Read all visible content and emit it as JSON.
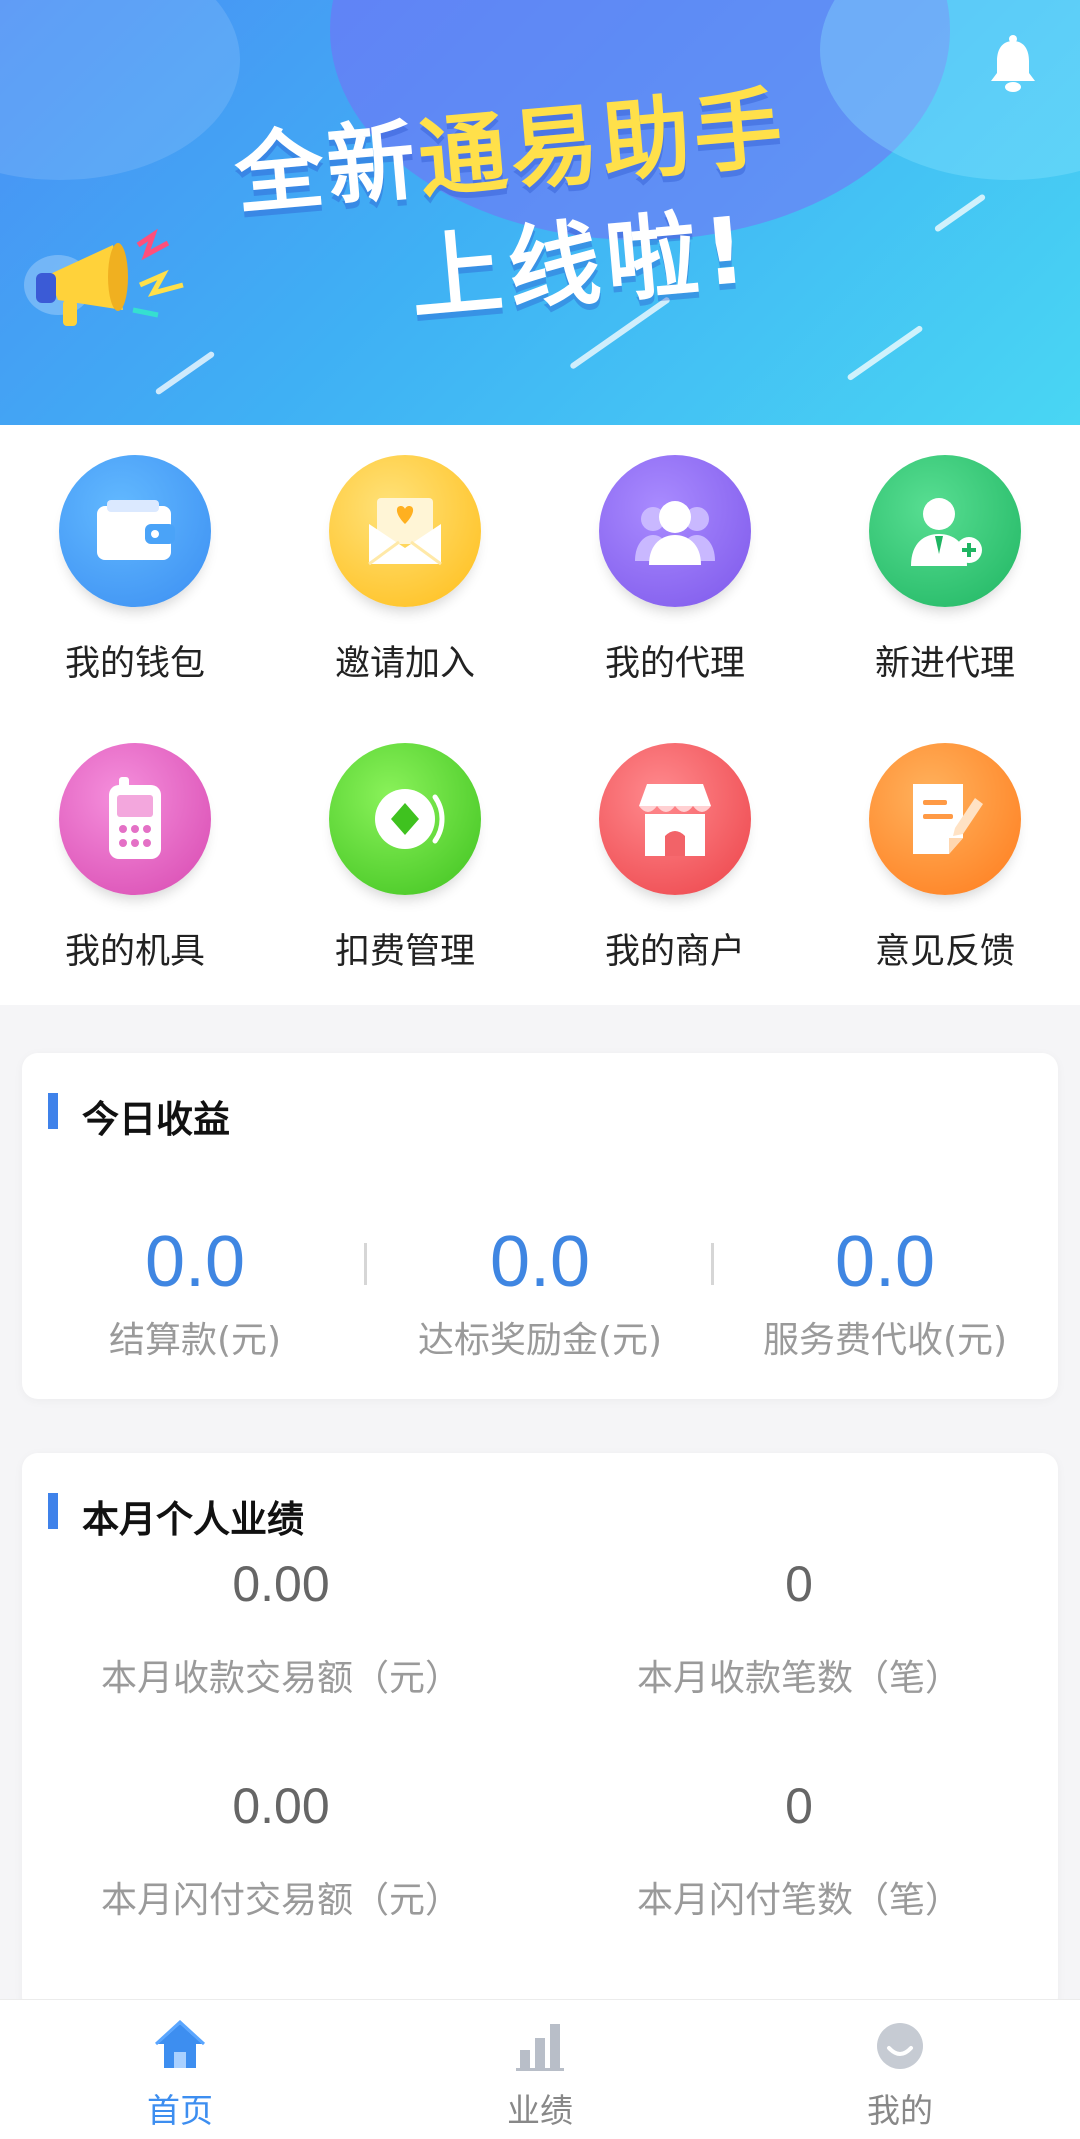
{
  "banner": {
    "title_line1_plain": "全新",
    "title_line1_highlight": "通易助手",
    "title_line2": "上线啦!"
  },
  "menu": {
    "items": [
      {
        "label": "我的钱包",
        "icon": "wallet-icon",
        "color": "#3b8ef2"
      },
      {
        "label": "邀请加入",
        "icon": "invite-envelope-icon",
        "color": "#ffc21f"
      },
      {
        "label": "我的代理",
        "icon": "agents-icon",
        "color": "#8c63ee"
      },
      {
        "label": "新进代理",
        "icon": "add-agent-icon",
        "color": "#27c06d"
      },
      {
        "label": "我的机具",
        "icon": "device-icon",
        "color": "#e85bc0"
      },
      {
        "label": "扣费管理",
        "icon": "fee-coin-icon",
        "color": "#5fd03a"
      },
      {
        "label": "我的商户",
        "icon": "shop-icon",
        "color": "#f2555a"
      },
      {
        "label": "意见反馈",
        "icon": "feedback-note-icon",
        "color": "#ff8a2a"
      }
    ]
  },
  "today": {
    "title": "今日收益",
    "stats": [
      {
        "value": "0.0",
        "label": "结算款(元)"
      },
      {
        "value": "0.0",
        "label": "达标奖励金(元)"
      },
      {
        "value": "0.0",
        "label": "服务费代收(元)"
      }
    ]
  },
  "month": {
    "title": "本月个人业绩",
    "stats": [
      {
        "value": "0.00",
        "label": "本月收款交易额（元）"
      },
      {
        "value": "0",
        "label": "本月收款笔数（笔）"
      },
      {
        "value": "0.00",
        "label": "本月闪付交易额（元）"
      },
      {
        "value": "0",
        "label": "本月闪付笔数（笔）"
      }
    ]
  },
  "tabbar": {
    "tabs": [
      {
        "label": "首页",
        "icon": "home-icon",
        "active": true
      },
      {
        "label": "业绩",
        "icon": "bar-chart-icon",
        "active": false
      },
      {
        "label": "我的",
        "icon": "profile-icon",
        "active": false
      }
    ]
  },
  "colors": {
    "accent": "#3f86e2",
    "tab_active": "#3d8ef0"
  }
}
